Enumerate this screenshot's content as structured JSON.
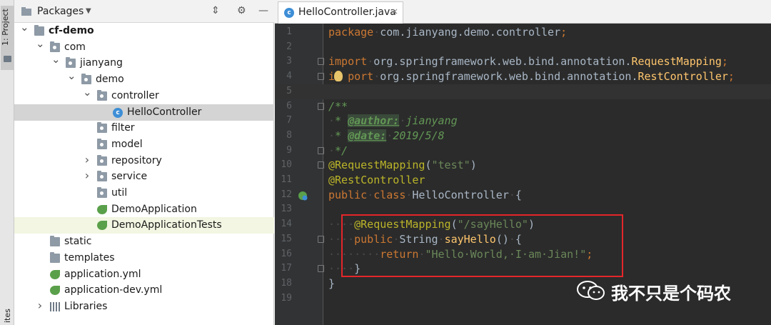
{
  "left_strip": {
    "project_tab_label": "1: Project",
    "bottom_label": "ites"
  },
  "panel": {
    "view_selector": "Packages",
    "tools": [
      "collapse-all-icon",
      "gear-icon",
      "hide-icon"
    ]
  },
  "tree": [
    {
      "label": "cf-demo",
      "icon": "module-folder-icon",
      "depth": 0,
      "arrow": "expanded",
      "bold": true
    },
    {
      "label": "com",
      "icon": "package-icon",
      "depth": 1,
      "arrow": "expanded"
    },
    {
      "label": "jianyang",
      "icon": "package-icon",
      "depth": 2,
      "arrow": "expanded"
    },
    {
      "label": "demo",
      "icon": "package-icon",
      "depth": 3,
      "arrow": "expanded"
    },
    {
      "label": "controller",
      "icon": "package-icon",
      "depth": 4,
      "arrow": "expanded"
    },
    {
      "label": "HelloController",
      "icon": "java-class-icon",
      "depth": 5,
      "arrow": "none",
      "state": "selected"
    },
    {
      "label": "filter",
      "icon": "package-icon",
      "depth": 4,
      "arrow": "none"
    },
    {
      "label": "model",
      "icon": "package-icon",
      "depth": 4,
      "arrow": "none"
    },
    {
      "label": "repository",
      "icon": "package-icon",
      "depth": 4,
      "arrow": "collapsed"
    },
    {
      "label": "service",
      "icon": "package-icon",
      "depth": 4,
      "arrow": "collapsed"
    },
    {
      "label": "util",
      "icon": "package-icon",
      "depth": 4,
      "arrow": "none"
    },
    {
      "label": "DemoApplication",
      "icon": "spring-boot-class-icon",
      "depth": 4,
      "arrow": "none"
    },
    {
      "label": "DemoApplicationTests",
      "icon": "spring-boot-test-icon",
      "depth": 4,
      "arrow": "none",
      "state": "highlighted"
    },
    {
      "label": "static",
      "icon": "resource-folder-icon",
      "depth": 1,
      "arrow": "none"
    },
    {
      "label": "templates",
      "icon": "resource-folder-icon",
      "depth": 1,
      "arrow": "none"
    },
    {
      "label": "application.yml",
      "icon": "spring-config-icon",
      "depth": 1,
      "arrow": "none"
    },
    {
      "label": "application-dev.yml",
      "icon": "spring-config-icon",
      "depth": 1,
      "arrow": "none"
    },
    {
      "label": "Libraries",
      "icon": "libraries-icon",
      "depth": 1,
      "arrow": "collapsed"
    }
  ],
  "editor_tab": {
    "label": "HelloController.java",
    "icon": "java-class-icon",
    "close": "×"
  },
  "code_lines": [
    {
      "n": "1",
      "tokens": [
        [
          "kw",
          "package"
        ],
        [
          "dim",
          "·"
        ],
        [
          "cls",
          "com.jianyang.demo.controller"
        ],
        [
          "kw",
          ";"
        ]
      ]
    },
    {
      "n": "2",
      "tokens": []
    },
    {
      "n": "3",
      "fold": true,
      "tokens": [
        [
          "kw",
          "import"
        ],
        [
          "dim",
          "·"
        ],
        [
          "cls",
          "org.springframework.web.bind.annotation."
        ],
        [
          "imp",
          "RequestMapping"
        ],
        [
          "kw",
          ";"
        ]
      ]
    },
    {
      "n": "4",
      "fold": true,
      "bulb": true,
      "tokens": [
        [
          "kw",
          "i"
        ],
        [
          "dim",
          "  "
        ],
        [
          "kw",
          "port"
        ],
        [
          "dim",
          "·"
        ],
        [
          "cls",
          "org.springframework.web.bind.annotation."
        ],
        [
          "imp",
          "RestController"
        ],
        [
          "kw",
          ";"
        ]
      ]
    },
    {
      "n": "5",
      "current": true,
      "tokens": []
    },
    {
      "n": "6",
      "fold": true,
      "tokens": [
        [
          "doc",
          "/**"
        ]
      ]
    },
    {
      "n": "7",
      "tokens": [
        [
          "dim",
          "·"
        ],
        [
          "doc",
          "* "
        ],
        [
          "doctag",
          "@author:"
        ],
        [
          "dim",
          "·"
        ],
        [
          "doc",
          "jianyang"
        ]
      ]
    },
    {
      "n": "8",
      "tokens": [
        [
          "dim",
          "·"
        ],
        [
          "doc",
          "* "
        ],
        [
          "doctag",
          "@date:"
        ],
        [
          "dim",
          "·"
        ],
        [
          "doc",
          "2019/5/8"
        ]
      ]
    },
    {
      "n": "9",
      "fold": true,
      "tokens": [
        [
          "dim",
          "·"
        ],
        [
          "doc",
          "*/"
        ]
      ]
    },
    {
      "n": "10",
      "fold": true,
      "tokens": [
        [
          "ann",
          "@RequestMapping"
        ],
        [
          "cls",
          "("
        ],
        [
          "str",
          "\"test\""
        ],
        [
          "cls",
          ")"
        ]
      ]
    },
    {
      "n": "11",
      "tokens": [
        [
          "ann",
          "@RestController"
        ]
      ]
    },
    {
      "n": "12",
      "gutter_icon": "spring-bean-icon",
      "tokens": [
        [
          "kw",
          "public"
        ],
        [
          "dim",
          "·"
        ],
        [
          "kw",
          "class"
        ],
        [
          "dim",
          "·"
        ],
        [
          "cls",
          "HelloController"
        ],
        [
          "dim",
          "·"
        ],
        [
          "cls",
          "{"
        ]
      ]
    },
    {
      "n": "13",
      "tokens": []
    },
    {
      "n": "14",
      "tokens": [
        [
          "dim",
          "····"
        ],
        [
          "ann",
          "@RequestMapping"
        ],
        [
          "cls",
          "("
        ],
        [
          "str",
          "\"/sayHello\""
        ],
        [
          "cls",
          ")"
        ]
      ]
    },
    {
      "n": "15",
      "fold": true,
      "tokens": [
        [
          "dim",
          "····"
        ],
        [
          "kw",
          "public"
        ],
        [
          "dim",
          "·"
        ],
        [
          "cls",
          "String"
        ],
        [
          "dim",
          "·"
        ],
        [
          "method",
          "sayHello"
        ],
        [
          "cls",
          "()"
        ],
        [
          "dim",
          "·"
        ],
        [
          "cls",
          "{"
        ]
      ]
    },
    {
      "n": "16",
      "tokens": [
        [
          "dim",
          "········"
        ],
        [
          "kw",
          "return"
        ],
        [
          "dim",
          "·"
        ],
        [
          "str",
          "\"Hello·World,·I·am·Jian!\""
        ],
        [
          "kw",
          ";"
        ]
      ]
    },
    {
      "n": "17",
      "fold": true,
      "tokens": [
        [
          "dim",
          "····"
        ],
        [
          "cls",
          "}"
        ]
      ]
    },
    {
      "n": "18",
      "tokens": [
        [
          "cls",
          "}"
        ]
      ]
    },
    {
      "n": "19",
      "tokens": []
    }
  ],
  "watermark": {
    "text": "我不只是个码农",
    "icon": "wechat-icon"
  },
  "colors": {
    "keyword": "#cc7832",
    "annotation": "#bbb529",
    "string": "#6a8759",
    "doc": "#629755",
    "method": "#ffc66d",
    "highlight_box": "#e4262a"
  }
}
